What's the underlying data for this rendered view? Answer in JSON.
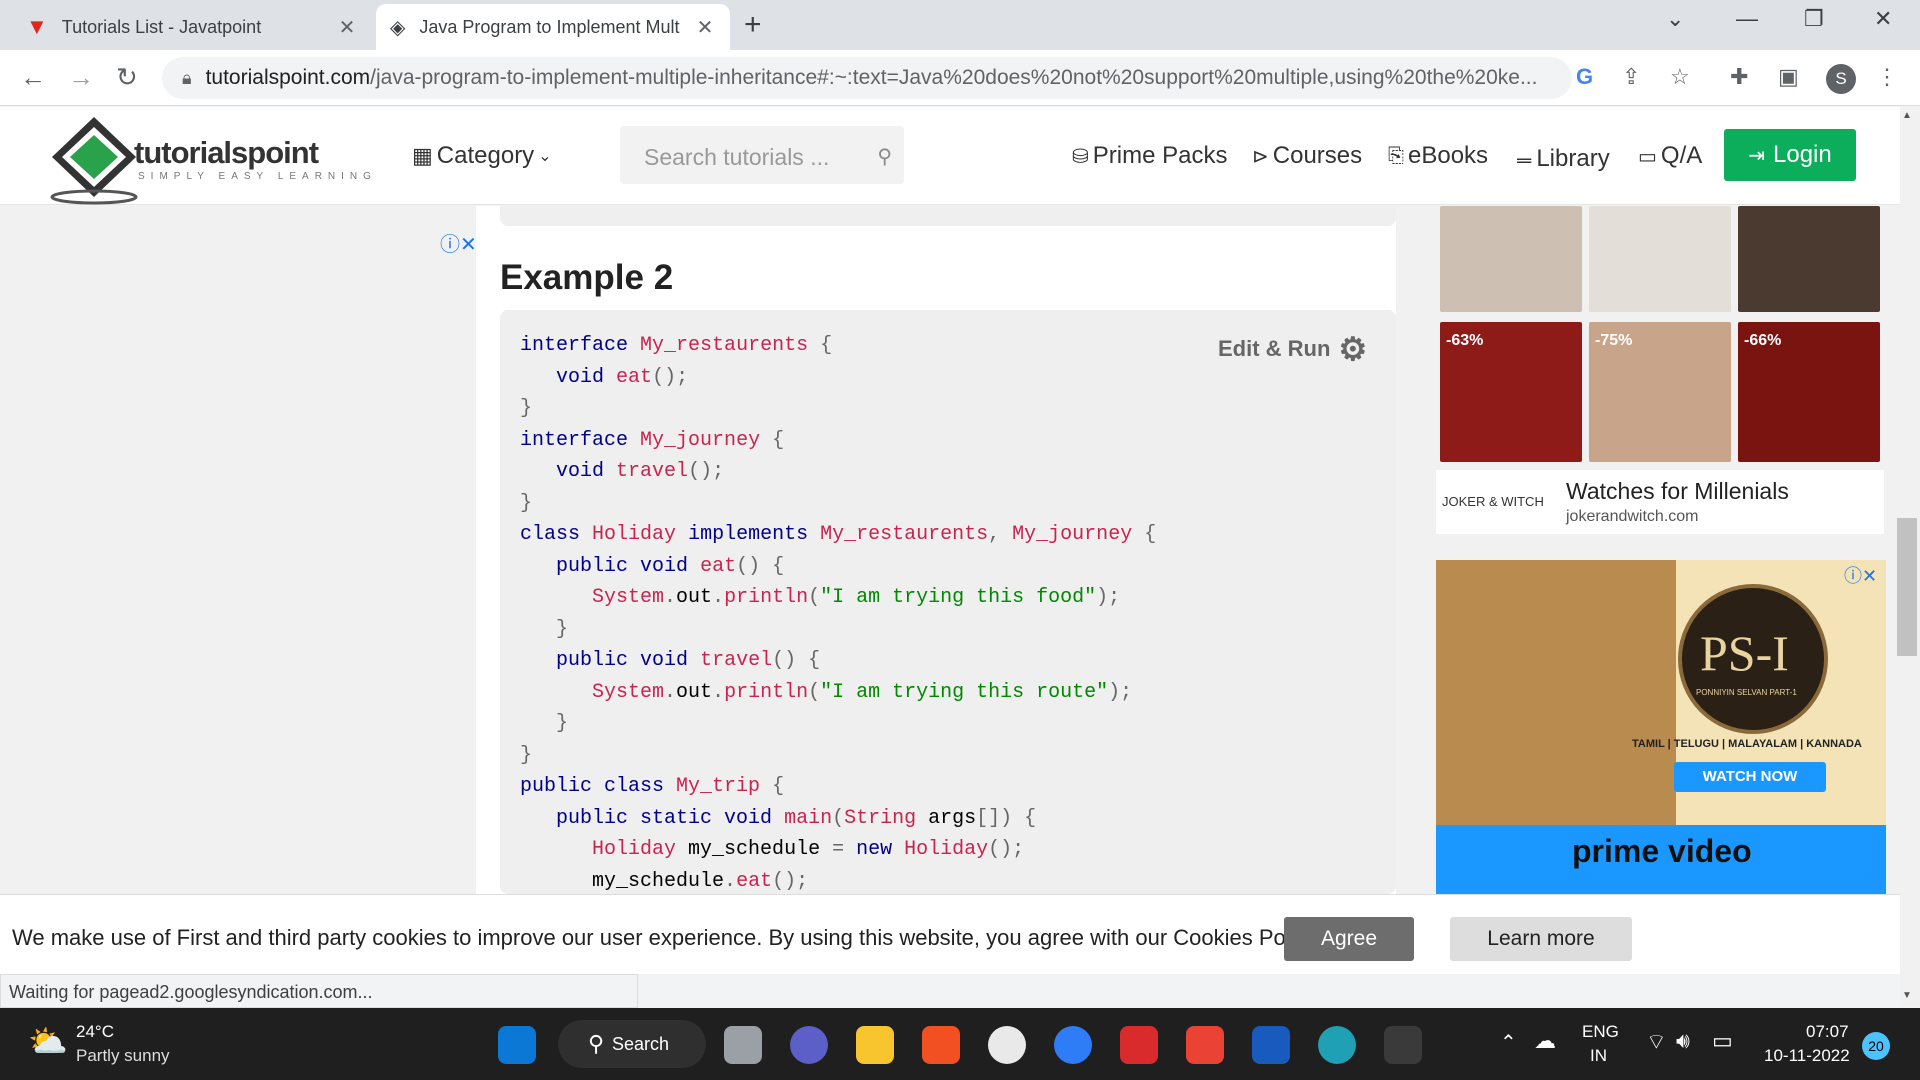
{
  "browser": {
    "tabs": [
      {
        "title": "Tutorials List - Javatpoint",
        "icon": "javatpoint-favicon-icon"
      },
      {
        "title": "Java Program to Implement Mult",
        "icon": "tutorialspoint-favicon-icon",
        "active": true
      }
    ],
    "url_host": "tutorialspoint.com",
    "url_path": "/java-program-to-implement-multiple-inheritance#:~:text=Java%20does%20not%20support%20multiple,using%20the%20ke...",
    "profile_initial": "S",
    "status": "Waiting for pagead2.googlesyndication.com..."
  },
  "site": {
    "logo_name": "tutorialspoint",
    "logo_tagline": "SIMPLY EASY LEARNING",
    "nav": {
      "category": "Category",
      "search_placeholder": "Search tutorials ...",
      "prime_packs": "Prime Packs",
      "courses": "Courses",
      "ebooks": "eBooks",
      "library": "Library",
      "qa": "Q/A",
      "login": "Login"
    }
  },
  "article": {
    "heading": "Example 2",
    "edit_run": "Edit & Run"
  },
  "ads": {
    "products": [
      {
        "badge": ""
      },
      {
        "badge": ""
      },
      {
        "badge": ""
      },
      {
        "badge": "-63%"
      },
      {
        "badge": "-75%"
      },
      {
        "badge": "-66%"
      }
    ],
    "brand": "JOKER & WITCH",
    "headline": "Watches for Millenials",
    "domain": "jokerandwitch.com",
    "movie_title": "PS-I",
    "movie_subtitle": "PONNIYIN SELVAN PART-1",
    "languages": "TAMIL | TELUGU | MALAYALAM | KANNADA",
    "cta": "WATCH NOW",
    "platform": "prime video"
  },
  "cookie": {
    "text": "We make use of First and third party cookies to improve our user experience. By using this website, you agree with our Cookies Policy.",
    "agree": "Agree",
    "learn_more": "Learn more"
  },
  "taskbar": {
    "weather_temp": "24°C",
    "weather_desc": "Partly sunny",
    "search": "Search",
    "lang_top": "ENG",
    "lang_bottom": "IN",
    "time": "07:07",
    "date": "10-11-2022",
    "notifications": "20"
  },
  "colors": {
    "login_green": "#0cae5c",
    "keyword": "#000088",
    "identifier": "#c7254e",
    "string": "#008800"
  }
}
